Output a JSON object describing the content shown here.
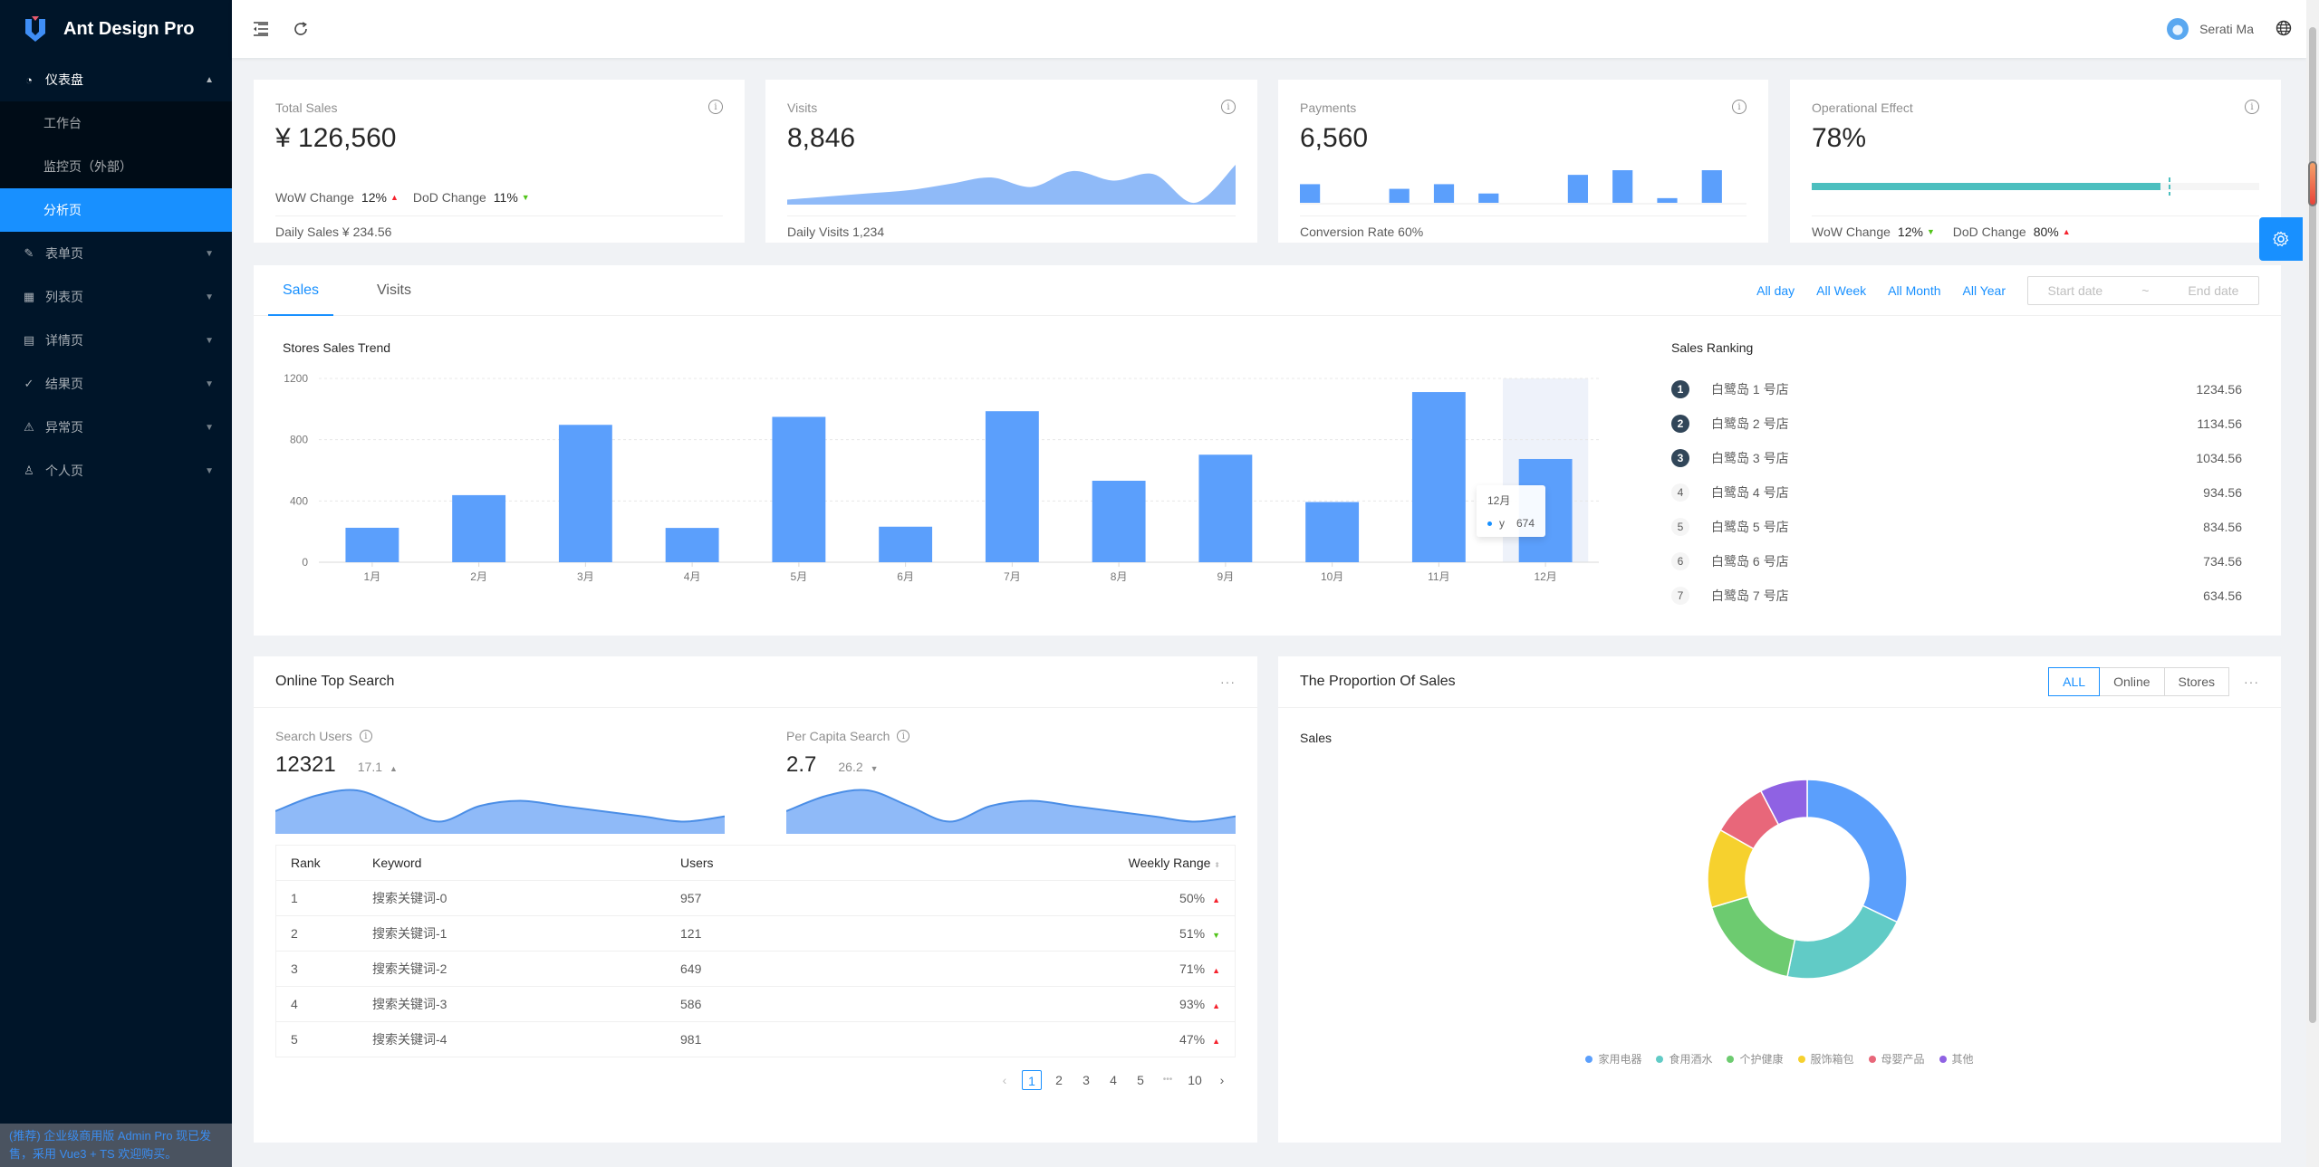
{
  "app": {
    "title": "Ant Design Pro"
  },
  "sidebar": {
    "items": [
      {
        "label": "仪表盘",
        "icon": "dashboard-icon",
        "open": true,
        "children": [
          {
            "label": "工作台"
          },
          {
            "label": "监控页（外部）"
          },
          {
            "label": "分析页",
            "active": true
          }
        ]
      },
      {
        "label": "表单页",
        "icon": "form-icon"
      },
      {
        "label": "列表页",
        "icon": "table-icon"
      },
      {
        "label": "详情页",
        "icon": "profile-icon"
      },
      {
        "label": "结果页",
        "icon": "check-circle-icon"
      },
      {
        "label": "异常页",
        "icon": "warning-icon"
      },
      {
        "label": "个人页",
        "icon": "user-icon"
      }
    ],
    "promo": "(推荐) 企业级商用版 Admin Pro 现已发售，采用 Vue3 + TS 欢迎购买。"
  },
  "header": {
    "user_name": "Serati Ma",
    "icons": [
      "menu-fold-icon",
      "reload-icon",
      "globe-icon"
    ]
  },
  "stats": {
    "total_sales": {
      "title": "Total Sales",
      "value": "¥ 126,560",
      "wow_label": "WoW Change",
      "wow_value": "12%",
      "wow_dir": "up",
      "dod_label": "DoD Change",
      "dod_value": "11%",
      "dod_dir": "down",
      "footer": "Daily Sales ¥ 234.56"
    },
    "visits": {
      "title": "Visits",
      "value": "8,846",
      "footer": "Daily Visits 1,234",
      "sparkline": [
        1,
        2,
        3,
        4,
        6,
        8,
        5,
        10,
        7,
        9,
        0,
        12
      ]
    },
    "payments": {
      "title": "Payments",
      "value": "6,560",
      "footer": "Conversion Rate 60%",
      "bars": [
        4,
        0,
        3,
        4,
        2,
        0,
        6,
        7,
        1,
        7
      ]
    },
    "operational": {
      "title": "Operational Effect",
      "value": "78%",
      "progress_percent": 78,
      "target_percent": 80,
      "wow_label": "WoW Change",
      "wow_value": "12%",
      "wow_dir": "down",
      "dod_label": "DoD Change",
      "dod_value": "80%",
      "dod_dir": "up"
    }
  },
  "sales_panel": {
    "tabs": [
      {
        "label": "Sales",
        "active": true
      },
      {
        "label": "Visits"
      }
    ],
    "ranges": [
      "All day",
      "All Week",
      "All Month",
      "All Year"
    ],
    "date_start_placeholder": "Start date",
    "date_separator": "~",
    "date_end_placeholder": "End date",
    "ranking_title": "Sales Ranking",
    "ranking": [
      {
        "rank": "1",
        "name": "白鹭岛 1 号店",
        "value": "1234.56"
      },
      {
        "rank": "2",
        "name": "白鹭岛 2 号店",
        "value": "1134.56"
      },
      {
        "rank": "3",
        "name": "白鹭岛 3 号店",
        "value": "1034.56"
      },
      {
        "rank": "4",
        "name": "白鹭岛 4 号店",
        "value": "934.56"
      },
      {
        "rank": "5",
        "name": "白鹭岛 5 号店",
        "value": "834.56"
      },
      {
        "rank": "6",
        "name": "白鹭岛 6 号店",
        "value": "734.56"
      },
      {
        "rank": "7",
        "name": "白鹭岛 7 号店",
        "value": "634.56"
      }
    ],
    "tooltip": {
      "title": "12月",
      "series": "y",
      "value": "674"
    }
  },
  "chart_data": [
    {
      "type": "bar",
      "title": "Stores Sales Trend",
      "categories": [
        "1月",
        "2月",
        "3月",
        "4月",
        "5月",
        "6月",
        "7月",
        "8月",
        "9月",
        "10月",
        "11月",
        "12月"
      ],
      "values": [
        225,
        438,
        897,
        224,
        949,
        232,
        986,
        532,
        702,
        393,
        1111,
        674
      ],
      "xlabel": "",
      "ylabel": "",
      "ylim": [
        0,
        1200
      ],
      "yticks": [
        0,
        400,
        800,
        1200
      ],
      "grid": true,
      "highlighted_category": "12月"
    },
    {
      "type": "pie",
      "title": "Sales",
      "donut": true,
      "labels": [
        "家用电器",
        "食用酒水",
        "个护健康",
        "服饰箱包",
        "母婴产品",
        "其他"
      ],
      "percent": [
        32.1,
        21.1,
        17.2,
        12.8,
        9.1,
        7.7
      ],
      "colors": [
        "#5b9ffc",
        "#61cbc6",
        "#6dcb70",
        "#f6d12e",
        "#e8677a",
        "#8f62e3"
      ],
      "legend": "bottom"
    },
    {
      "type": "area",
      "title": "Search Users",
      "values": [
        4,
        7,
        8,
        5,
        2,
        5,
        6,
        5,
        4,
        3,
        2,
        3
      ]
    },
    {
      "type": "area",
      "title": "Per Capita Search",
      "values": [
        4,
        7,
        8,
        5,
        2,
        5,
        6,
        5,
        4,
        3,
        2,
        3
      ]
    }
  ],
  "top_search": {
    "title": "Online Top Search",
    "more": "···",
    "search_users": {
      "label": "Search Users",
      "value": "12321",
      "sub": "17.1",
      "dir": "up"
    },
    "per_capita": {
      "label": "Per Capita Search",
      "value": "2.7",
      "sub": "26.2",
      "dir": "down"
    },
    "columns": [
      "Rank",
      "Keyword",
      "Users",
      "Weekly Range"
    ],
    "rows": [
      {
        "rank": "1",
        "keyword": "搜索关键词-0",
        "users": "957",
        "range": "50%",
        "dir": "up"
      },
      {
        "rank": "2",
        "keyword": "搜索关键词-1",
        "users": "121",
        "range": "51%",
        "dir": "down"
      },
      {
        "rank": "3",
        "keyword": "搜索关键词-2",
        "users": "649",
        "range": "71%",
        "dir": "up"
      },
      {
        "rank": "4",
        "keyword": "搜索关键词-3",
        "users": "586",
        "range": "93%",
        "dir": "up"
      },
      {
        "rank": "5",
        "keyword": "搜索关键词-4",
        "users": "981",
        "range": "47%",
        "dir": "up"
      }
    ],
    "pagination": {
      "pages": [
        "1",
        "2",
        "3",
        "4",
        "5"
      ],
      "ellipsis": "•••",
      "last": "10",
      "current": "1",
      "prev": "‹",
      "next": "›"
    }
  },
  "proportion": {
    "title": "The Proportion Of Sales",
    "segments": [
      {
        "label": "ALL",
        "active": true
      },
      {
        "label": "Online"
      },
      {
        "label": "Stores"
      }
    ],
    "more": "···",
    "subtitle": "Sales"
  }
}
